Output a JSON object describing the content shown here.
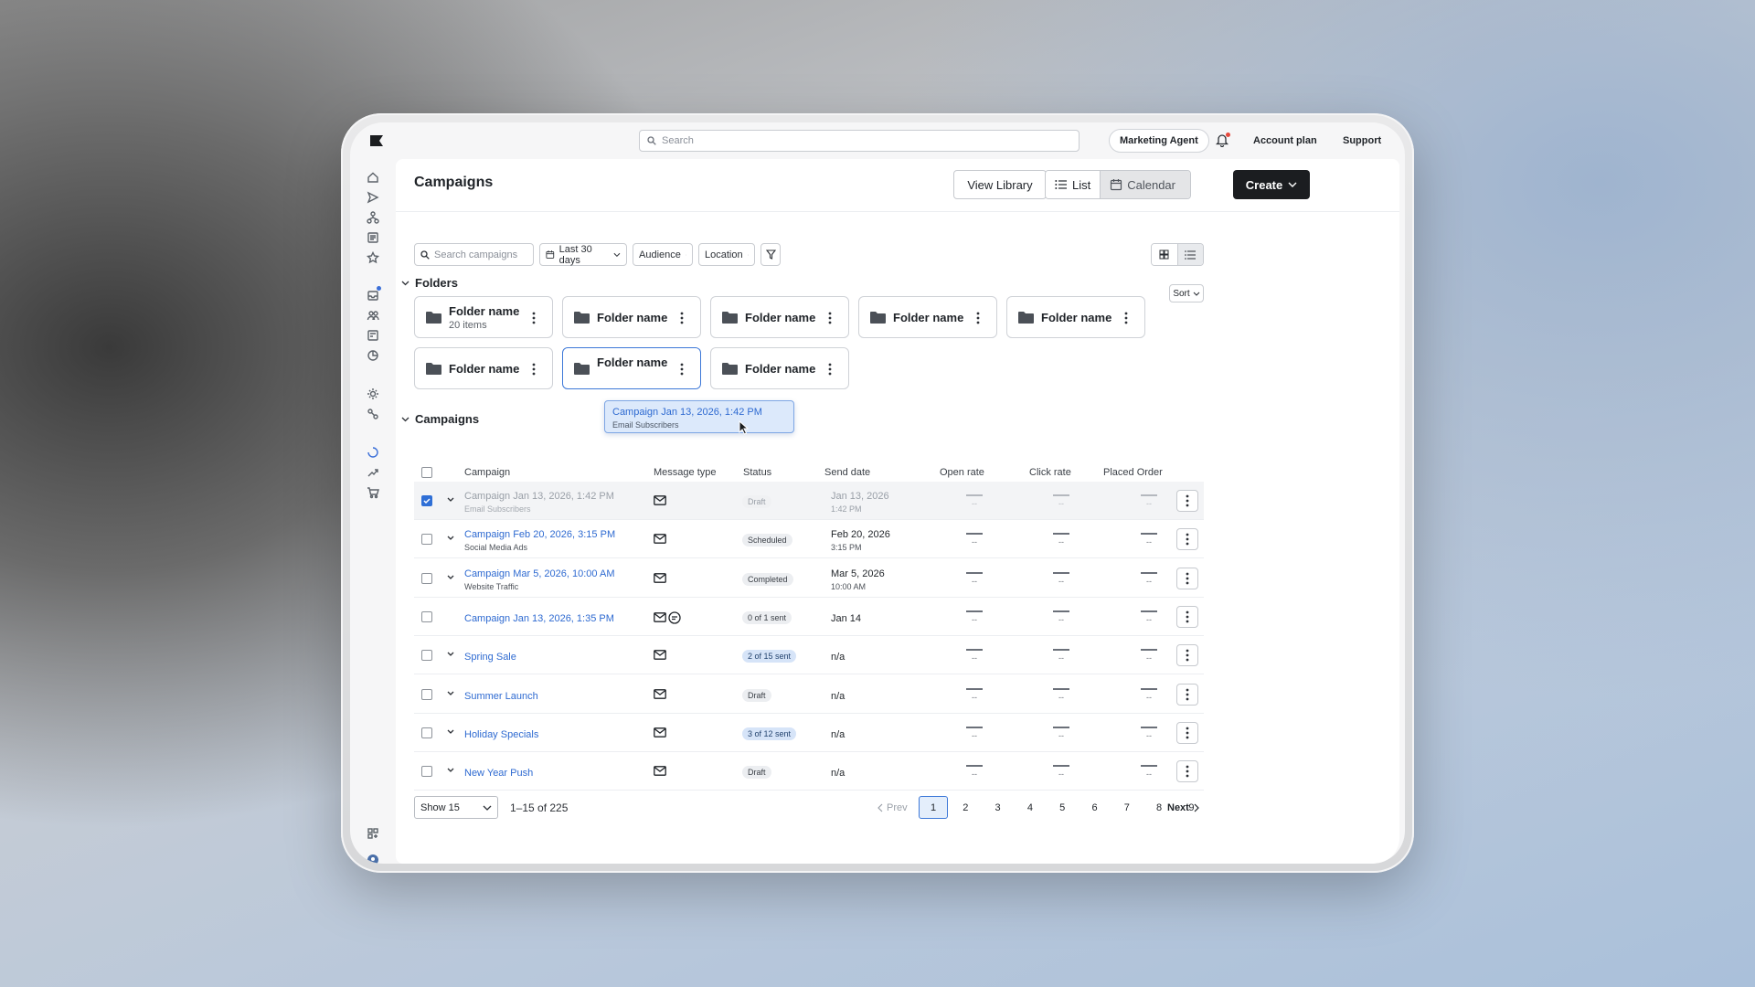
{
  "topbar": {
    "search_placeholder": "Search",
    "agent": "Marketing Agent",
    "account": "Account plan",
    "support": "Support"
  },
  "rail": [
    "home-icon",
    "send-icon",
    "flow-icon",
    "list-icon",
    "star-icon",
    "inbox-icon",
    "audience-icon",
    "form-icon",
    "analytics-icon",
    "idea-icon",
    "integration-icon",
    "loader-icon",
    "trend-icon",
    "cart-icon",
    "apps-icon",
    "account-icon"
  ],
  "header": {
    "title": "Campaigns",
    "view_library": "View Library",
    "list": "List",
    "calendar": "Calendar",
    "create": "Create"
  },
  "filters": {
    "search_placeholder": "Search campaigns",
    "date": "Last 30 days",
    "audience": "Audience",
    "location": "Location"
  },
  "folders": {
    "title": "Folders",
    "sort": "Sort",
    "items": [
      {
        "name": "Folder name",
        "sub": "20 items"
      },
      {
        "name": "Folder name"
      },
      {
        "name": "Folder name"
      },
      {
        "name": "Folder name"
      },
      {
        "name": "Folder name"
      },
      {
        "name": "Folder name"
      },
      {
        "name": "Folder name"
      },
      {
        "name": "Folder name"
      }
    ]
  },
  "drag": {
    "title": "Campaign Jan 13, 2026, 1:42 PM",
    "sub": "Email Subscribers"
  },
  "campaigns": {
    "title": "Campaigns",
    "columns": [
      "Campaign",
      "Message type",
      "Status",
      "Send date",
      "Open rate",
      "Click rate",
      "Placed Order"
    ],
    "rows": [
      {
        "name": "Campaign Jan 13, 2026, 1:42 PM",
        "sub": "Email Subscribers",
        "status": "Draft",
        "date": "Jan 13, 2026",
        "time": "1:42 PM",
        "checked": true,
        "expand": true,
        "types": [
          "email"
        ]
      },
      {
        "name": "Campaign Feb 20, 2026, 3:15 PM",
        "sub": "Social Media Ads",
        "status": "Scheduled",
        "date": "Feb 20, 2026",
        "time": "3:15 PM",
        "expand": true,
        "types": [
          "email"
        ]
      },
      {
        "name": "Campaign Mar 5, 2026, 10:00 AM",
        "sub": "Website Traffic",
        "status": "Completed",
        "date": "Mar 5, 2026",
        "time": "10:00 AM",
        "expand": true,
        "types": [
          "email"
        ]
      },
      {
        "name": "Campaign Jan 13, 2026, 1:35 PM",
        "status": "0 of 1 sent",
        "date": "Jan 14",
        "expand": false,
        "types": [
          "email",
          "sms"
        ]
      },
      {
        "name": "Spring Sale",
        "status": "2 of 15 sent",
        "status_blue": true,
        "date": "n/a",
        "expand": true,
        "types": [
          "email"
        ]
      },
      {
        "name": "Summer Launch",
        "status": "Draft",
        "date": "n/a",
        "expand": true,
        "types": [
          "email"
        ]
      },
      {
        "name": "Holiday Specials",
        "status": "3 of 12 sent",
        "status_blue": true,
        "date": "n/a",
        "expand": true,
        "types": [
          "email"
        ]
      },
      {
        "name": "New Year Push",
        "status": "Draft",
        "date": "n/a",
        "expand": true,
        "types": [
          "email"
        ]
      }
    ],
    "metric_placeholder": "--"
  },
  "pagination": {
    "show": "Show 15",
    "count": "1–15 of 225",
    "prev": "Prev",
    "next": "Next",
    "pages": [
      "1",
      "2",
      "3",
      "4",
      "5",
      "6",
      "7",
      "8",
      "9"
    ],
    "current": "1"
  }
}
